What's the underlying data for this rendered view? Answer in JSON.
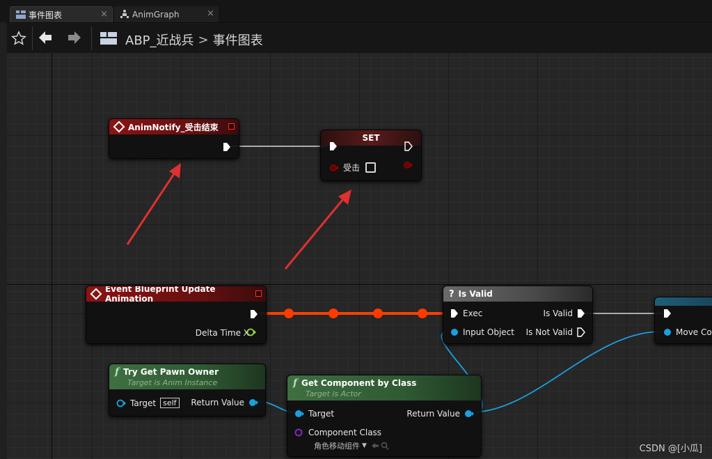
{
  "tabs": [
    {
      "label": "事件图表",
      "active": true,
      "close": "×"
    },
    {
      "label": "AnimGraph",
      "active": false,
      "close": "×"
    }
  ],
  "toolbar": {
    "breadcrumb": {
      "root": "ABP_近战兵",
      "separator": ">",
      "current": "事件图表"
    }
  },
  "nodes": {
    "anim_notify": {
      "title": "AnimNotify_受击结束"
    },
    "set": {
      "title": "SET",
      "var_label": "受击"
    },
    "event_update": {
      "title": "Event Blueprint Update Animation",
      "pin_delta": "Delta Time X"
    },
    "is_valid": {
      "title": "Is Valid",
      "pin_exec": "Exec",
      "pin_input": "Input Object",
      "pin_valid": "Is Valid",
      "pin_not_valid": "Is Not Valid"
    },
    "pawn_owner": {
      "title": "Try Get Pawn Owner",
      "subtitle": "Target is Anim Instance",
      "pin_target": "Target",
      "self_label": "self",
      "pin_return": "Return Value"
    },
    "get_component": {
      "title": "Get Component by Class",
      "subtitle": "Target is Actor",
      "pin_target": "Target",
      "pin_return": "Return Value",
      "pin_class": "Component Class",
      "class_value": "角色移动组件"
    },
    "move_comp": {
      "pin_label": "Move Cor"
    }
  },
  "watermark": "CSDN @[小瓜]",
  "colors": {
    "exec_wire": "#d8d8d8",
    "active_wire": "#ff4000",
    "object_wire": "#1aa0e0",
    "annotation_arrow": "#e03030"
  }
}
